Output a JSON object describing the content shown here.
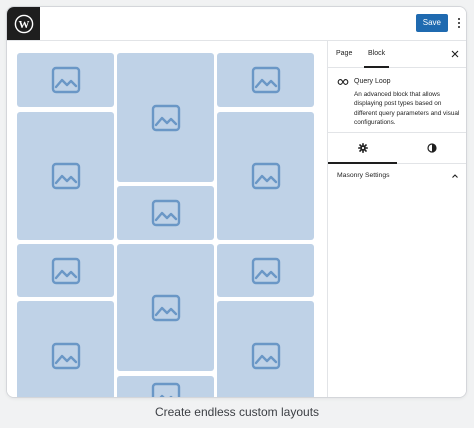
{
  "toolbar": {
    "save_label": "Save"
  },
  "sidebar": {
    "tabs": [
      {
        "label": "Page"
      },
      {
        "label": "Block"
      }
    ],
    "block": {
      "icon": "query-loop-icon",
      "title": "Query Loop",
      "description": "An advanced block that allows displaying post types based on different query parameters and visual configurations."
    },
    "settings_tabs": [
      {
        "icon": "gear-icon"
      },
      {
        "icon": "contrast-icon"
      }
    ],
    "panel": {
      "title": "Masonry Settings"
    }
  },
  "caption": "Create endless custom layouts",
  "colors": {
    "tile": "#bfd2e7",
    "tile_icon": "#6a97c6",
    "save_button": "#1f6ab0",
    "logo_bg": "#1e1e1e"
  }
}
